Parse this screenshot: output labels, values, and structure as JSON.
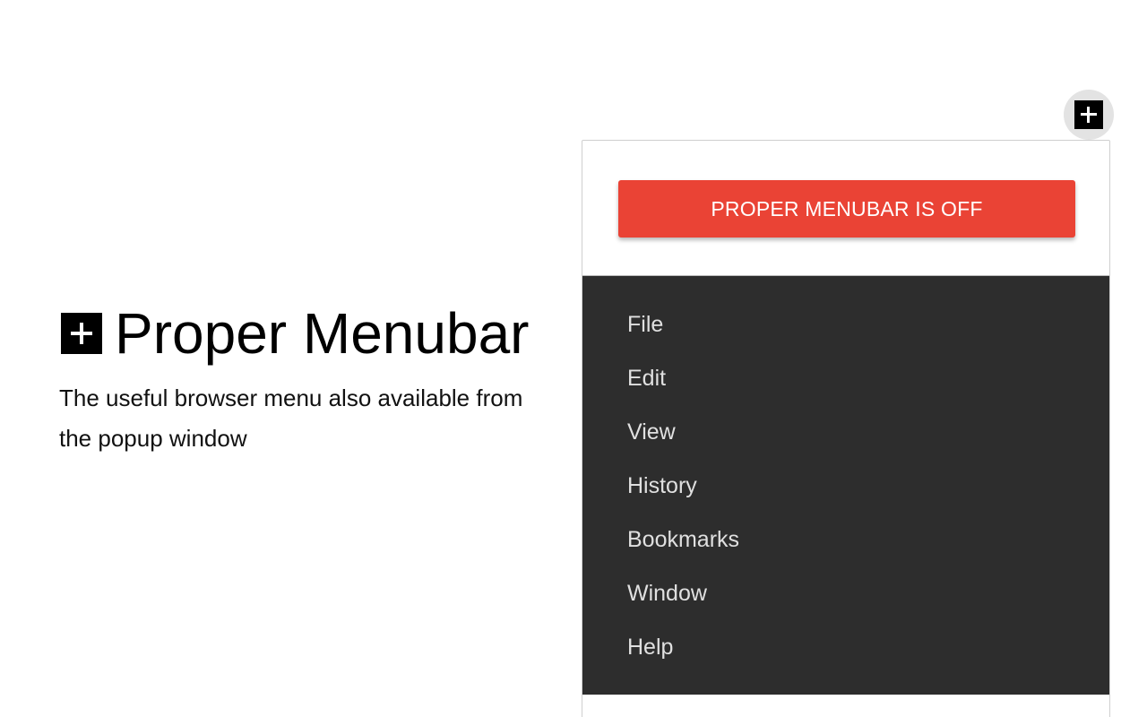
{
  "hero": {
    "title": "Proper Menubar",
    "subtitle": "The useful browser menu also available from the popup window",
    "logo_icon": "plus-square-icon"
  },
  "toolbar": {
    "extension_icon": "plus-square-icon"
  },
  "popup": {
    "toggle_label": "PROPER MENUBAR IS OFF",
    "toggle_color": "#ea4335",
    "menu_background": "#2d2d2d",
    "menu_items": [
      {
        "label": "File"
      },
      {
        "label": "Edit"
      },
      {
        "label": "View"
      },
      {
        "label": "History"
      },
      {
        "label": "Bookmarks"
      },
      {
        "label": "Window"
      },
      {
        "label": "Help"
      }
    ]
  }
}
